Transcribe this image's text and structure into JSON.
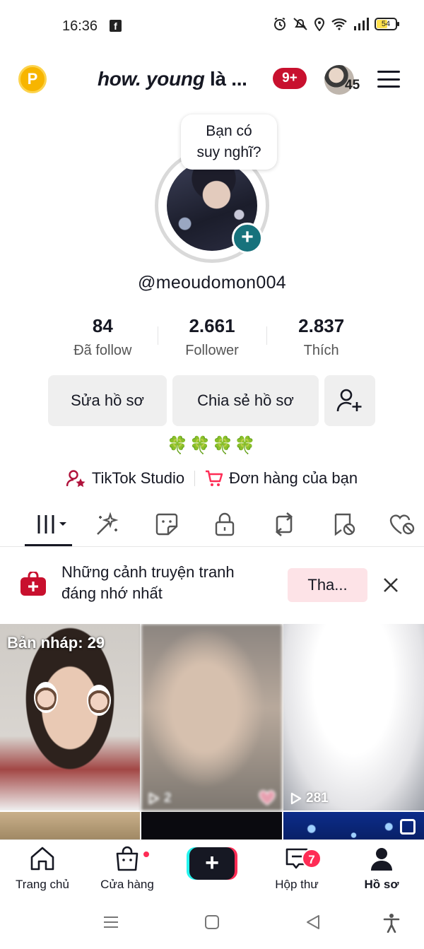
{
  "status_bar": {
    "time": "16:36",
    "battery": "54",
    "icons": [
      "facebook-icon",
      "alarm-icon",
      "mute-icon",
      "location-icon",
      "wifi-icon",
      "signal-icon",
      "battery-icon"
    ]
  },
  "header": {
    "coin_label": "P",
    "name_italic": "how. young",
    "name_rest": " là ...",
    "notification_badge": "9+",
    "friends_count": "45"
  },
  "profile": {
    "thought_bubble": [
      "Bạn có",
      "suy nghĩ?"
    ],
    "add_symbol": "+",
    "username": "@meoudomon004",
    "stats": [
      {
        "value": "84",
        "label": "Đã follow"
      },
      {
        "value": "2.661",
        "label": "Follower"
      },
      {
        "value": "2.837",
        "label": "Thích"
      }
    ],
    "edit_button": "Sửa hồ sơ",
    "share_button": "Chia sẻ hồ sơ",
    "bio": "🍀🍀🍀🍀",
    "links": {
      "studio": "TikTok Studio",
      "orders": "Đơn hàng của bạn"
    }
  },
  "tabs": [
    "videos-grid-icon",
    "effects-icon",
    "stickers-icon",
    "private-lock-icon",
    "repost-icon",
    "favorites-icon",
    "liked-icon"
  ],
  "promo": {
    "text_line1": "Những cảnh truyện tranh",
    "text_line2": "đáng nhớ nhất",
    "button": "Tha..."
  },
  "grid": {
    "draft_label": "Bản nháp: 29",
    "items": [
      {
        "views": "2"
      },
      {
        "views": "281"
      }
    ]
  },
  "bottom_nav": {
    "home": "Trang chủ",
    "shop": "Cửa hàng",
    "create": "+",
    "inbox": "Hộp thư",
    "inbox_badge": "7",
    "profile": "Hồ sơ"
  },
  "colors": {
    "brand_red": "#fe2c55",
    "notif_red": "#c8102e",
    "add_teal": "#17727c",
    "cyan": "#25f4ee"
  }
}
